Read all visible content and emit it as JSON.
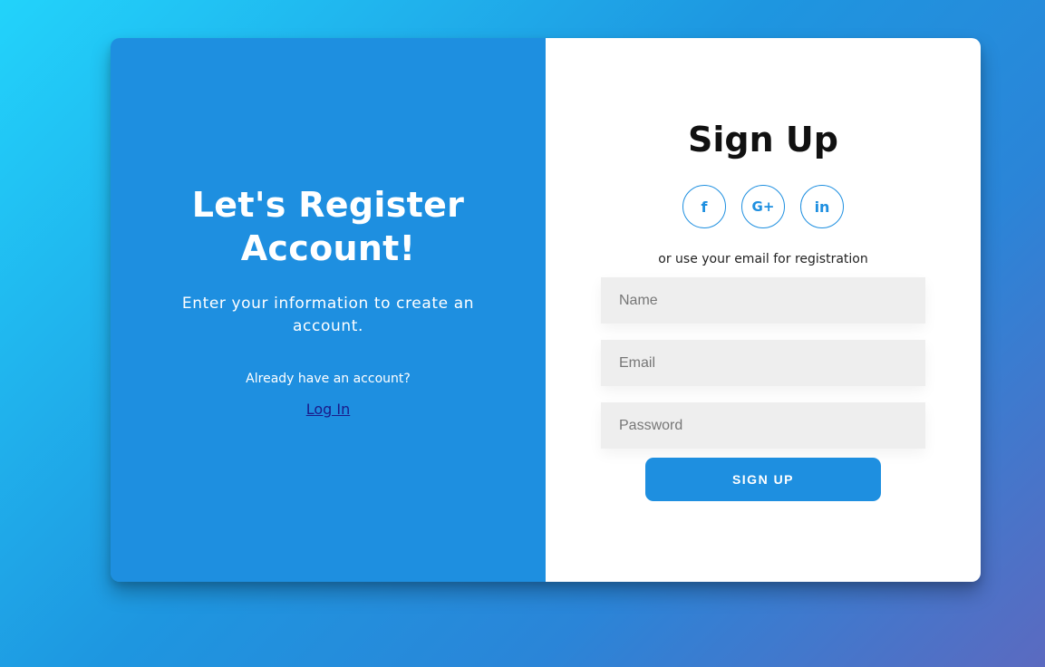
{
  "left_panel": {
    "title_line1": "Let's Register",
    "title_line2": "Account!",
    "description": "Enter your information to create an account.",
    "already_text": "Already have an account?",
    "login_link": "Log In"
  },
  "right_panel": {
    "title": "Sign Up",
    "social": {
      "facebook": "f",
      "google": "G+",
      "linkedin": "in"
    },
    "or_text": "or use your email for registration",
    "fields": {
      "name_placeholder": "Name",
      "email_placeholder": "Email",
      "password_placeholder": "Password"
    },
    "submit_label": "SIGN UP"
  },
  "colors": {
    "accent": "#1e8fe0",
    "background_start": "#22d3fb",
    "background_end": "#5b6ac0",
    "input_bg": "#eeeeee",
    "link": "#1a1a8a"
  },
  "icons": {
    "facebook": "facebook-icon",
    "google": "google-plus-icon",
    "linkedin": "linkedin-icon"
  }
}
